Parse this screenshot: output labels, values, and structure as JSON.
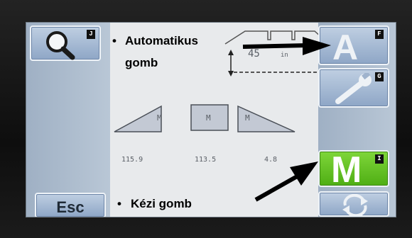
{
  "buttons": {
    "search_key": "J",
    "auto_letter": "A",
    "auto_key": "F",
    "wrench_key": "G",
    "manual_letter": "M",
    "manual_key": "I",
    "esc_label": "Esc"
  },
  "display": {
    "height_value": "45",
    "height_unit": "in",
    "section_left_label": "M",
    "section_center_label": "M",
    "section_right_label": "M",
    "reading_left": "115.9",
    "reading_center": "113.5",
    "reading_right": "4.8"
  },
  "annotations": {
    "auto_bullet": "•",
    "auto_line1": "Automatikus",
    "auto_line2": "gomb",
    "manual_bullet": "•",
    "manual_text": "Kézi gomb"
  },
  "colors": {
    "button_blue": "#9fb4cf",
    "manual_green": "#5fc31f",
    "screen_bg": "#e8eaec"
  }
}
